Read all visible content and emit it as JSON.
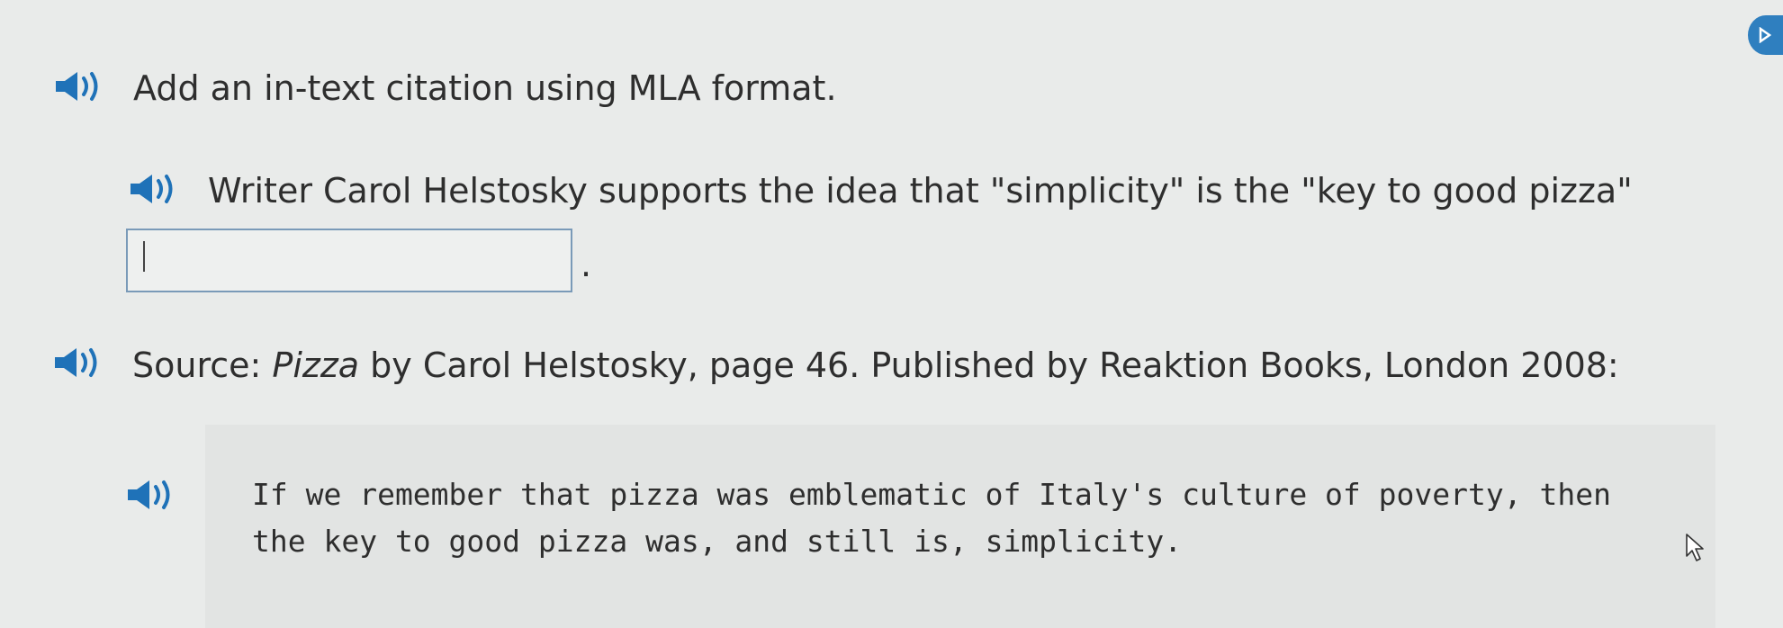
{
  "instruction": {
    "text": "Add an in-text citation using MLA format."
  },
  "sentence": {
    "text": "Writer Carol Helstosky supports the idea that \"simplicity\" is the \"key to good pizza\""
  },
  "citation_input": {
    "value": ""
  },
  "period": ".",
  "source": {
    "prefix": "Source: ",
    "title": "Pizza",
    "rest": " by Carol Helstosky, page 46. Published by Reaktion Books, London 2008:"
  },
  "quote": {
    "line1": "If we remember that pizza was emblematic of Italy's culture of poverty, then",
    "line2": "the key to good pizza was, and still is, simplicity."
  },
  "icons": {
    "speaker": "speaker-icon",
    "badge": "next-arrow-icon",
    "cursor": "mouse-pointer-icon"
  },
  "colors": {
    "background": "#e9ebea",
    "speaker": "#1f72b8",
    "input_border": "#7a9ab8",
    "quote_panel": "#e2e4e3",
    "badge": "#2f7fbf"
  }
}
